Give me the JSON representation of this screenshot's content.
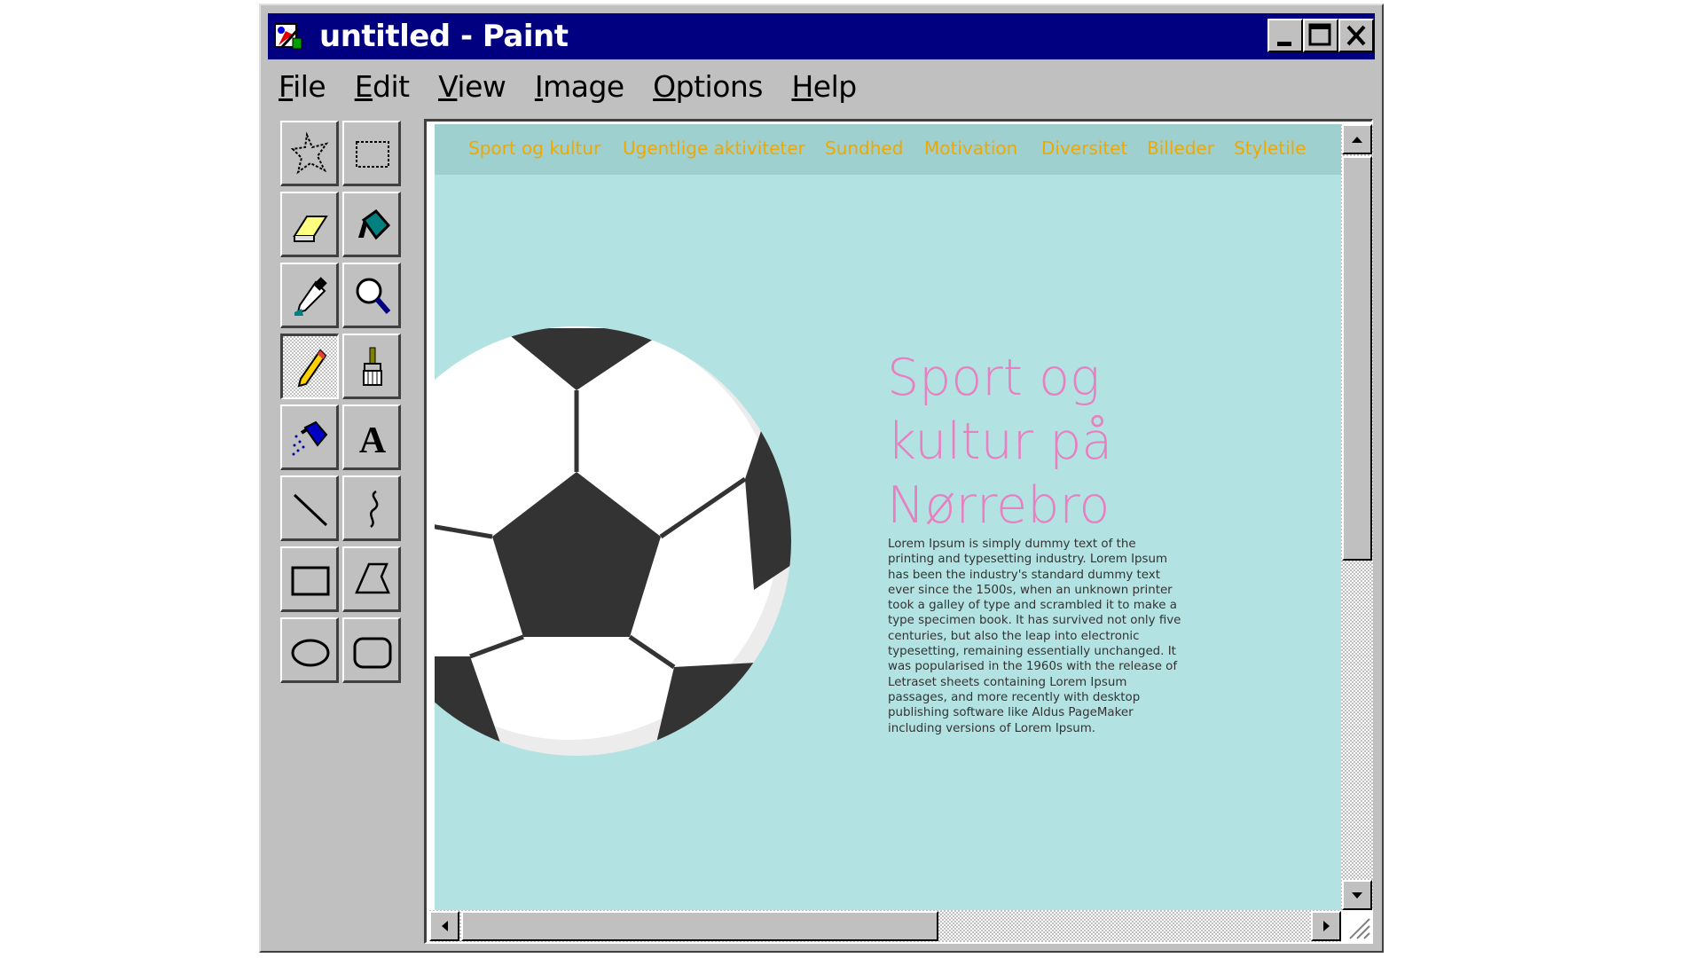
{
  "window": {
    "title": "untitled - Paint"
  },
  "menu": [
    {
      "underline": "F",
      "rest": "ile"
    },
    {
      "underline": "E",
      "rest": "dit"
    },
    {
      "underline": "V",
      "rest": "iew"
    },
    {
      "underline": "I",
      "rest": "mage"
    },
    {
      "underline": "O",
      "rest": "ptions"
    },
    {
      "underline": "H",
      "rest": "elp"
    }
  ],
  "tools": [
    "free-form-select-icon",
    "select-icon",
    "eraser-icon",
    "fill-with-color-icon",
    "pick-color-icon",
    "magnifier-icon",
    "pencil-icon",
    "brush-icon",
    "airbrush-icon",
    "text-icon",
    "line-icon",
    "curve-icon",
    "rectangle-icon",
    "polygon-icon",
    "ellipse-icon",
    "rounded-rectangle-icon"
  ],
  "active_tool": "pencil-icon",
  "canvas": {
    "nav": [
      "Sport og kultur",
      "Ugentlige aktiviteter",
      "Sundhed",
      "Motivation",
      "Diversitet",
      "Billeder",
      "Styletile"
    ],
    "hero_title": [
      "Sport og",
      "kultur på",
      "Nørrebro"
    ],
    "hero_body": [
      "Lorem Ipsum is simply dummy text of the",
      "printing and typesetting industry. Lorem Ipsum",
      "has been the industry's standard dummy text",
      "ever since the 1500s, when an unknown printer",
      "took a galley of type and scrambled it to make a",
      "type specimen book. It has survived not only five",
      "centuries, but also the leap into electronic",
      "typesetting, remaining essentially unchanged. It",
      "was popularised in the 1960s with the release of",
      "Letraset sheets containing Lorem Ipsum",
      "passages, and more recently with desktop",
      "publishing software like Aldus PageMaker",
      "including versions of Lorem Ipsum."
    ],
    "colors": {
      "background": "#b3e2e2",
      "nav_bg": "#9fd0d0",
      "nav_text": "#f0a800",
      "title": "#e77fc0",
      "ball_dark": "#333333"
    }
  }
}
